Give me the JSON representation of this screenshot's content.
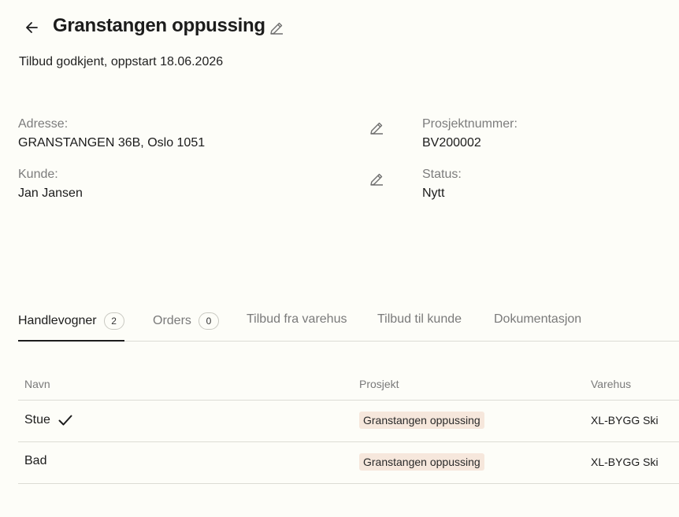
{
  "header": {
    "title": "Granstangen oppussing",
    "subtitle": "Tilbud godkjent, oppstart 18.06.2026"
  },
  "info": {
    "address_label": "Adresse:",
    "address_value": "GRANSTANGEN 36B, Oslo 1051",
    "customer_label": "Kunde:",
    "customer_value": "Jan Jansen",
    "project_number_label": "Prosjektnummer:",
    "project_number_value": "BV200002",
    "status_label": "Status:",
    "status_value": "Nytt"
  },
  "tabs": [
    {
      "label": "Handlevogner",
      "count": "2",
      "active": true
    },
    {
      "label": "Orders",
      "count": "0",
      "active": false
    },
    {
      "label": "Tilbud fra varehus",
      "active": false
    },
    {
      "label": "Tilbud til kunde",
      "active": false
    },
    {
      "label": "Dokumentasjon",
      "active": false
    }
  ],
  "table": {
    "columns": [
      "Navn",
      "Prosjekt",
      "Varehus"
    ],
    "rows": [
      {
        "name": "Stue",
        "checked": true,
        "project": "Granstangen oppussing",
        "warehouse": "XL-BYGG Ski"
      },
      {
        "name": "Bad",
        "checked": false,
        "project": "Granstangen oppussing",
        "warehouse": "XL-BYGG Ski"
      }
    ]
  },
  "icons": {
    "back": "arrow-left-icon",
    "edit": "pencil-icon",
    "check": "checkmark-icon"
  }
}
